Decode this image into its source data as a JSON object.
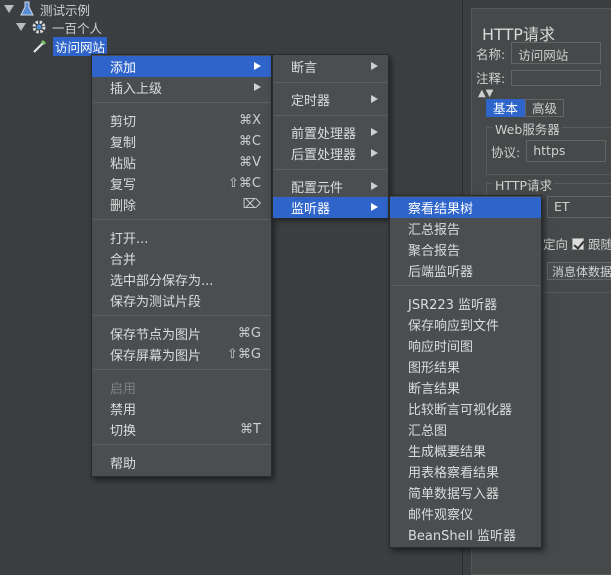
{
  "tree": {
    "root": "测试示例",
    "thread_group": "一百个人",
    "sampler": "访问网站"
  },
  "panel": {
    "title": "HTTP请求",
    "name_label": "名称:",
    "name_value": "访问网站",
    "comment_label": "注释:",
    "tab_basic": "基本",
    "tab_advanced": "高级",
    "web_server_group": "Web服务器",
    "protocol_label": "协议:",
    "protocol_value": "https",
    "http_request_group": "HTTP请求",
    "method_value": "ET",
    "redirect_label": "定向",
    "follow_label": "跟随",
    "body_tab": "消息体数据",
    "extra_tab": "文"
  },
  "context_menu": {
    "items": [
      {
        "label": "添加",
        "shortcut": "",
        "submenu": true,
        "highlighted": true,
        "disabled": false
      },
      {
        "label": "插入上级",
        "shortcut": "",
        "submenu": true,
        "highlighted": false,
        "disabled": false
      },
      {
        "label": "剪切",
        "shortcut": "⌘X",
        "submenu": false,
        "highlighted": false,
        "disabled": false
      },
      {
        "label": "复制",
        "shortcut": "⌘C",
        "submenu": false,
        "highlighted": false,
        "disabled": false
      },
      {
        "label": "粘贴",
        "shortcut": "⌘V",
        "submenu": false,
        "highlighted": false,
        "disabled": false
      },
      {
        "label": "复写",
        "shortcut": "⇧⌘C",
        "submenu": false,
        "highlighted": false,
        "disabled": false
      },
      {
        "label": "删除",
        "shortcut": "⌦",
        "submenu": false,
        "highlighted": false,
        "disabled": false
      },
      {
        "label": "打开...",
        "shortcut": "",
        "submenu": false,
        "highlighted": false,
        "disabled": false
      },
      {
        "label": "合并",
        "shortcut": "",
        "submenu": false,
        "highlighted": false,
        "disabled": false
      },
      {
        "label": "选中部分保存为...",
        "shortcut": "",
        "submenu": false,
        "highlighted": false,
        "disabled": false
      },
      {
        "label": "保存为测试片段",
        "shortcut": "",
        "submenu": false,
        "highlighted": false,
        "disabled": false
      },
      {
        "label": "保存节点为图片",
        "shortcut": "⌘G",
        "submenu": false,
        "highlighted": false,
        "disabled": false
      },
      {
        "label": "保存屏幕为图片",
        "shortcut": "⇧⌘G",
        "submenu": false,
        "highlighted": false,
        "disabled": false
      },
      {
        "label": "启用",
        "shortcut": "",
        "submenu": false,
        "highlighted": false,
        "disabled": true
      },
      {
        "label": "禁用",
        "shortcut": "",
        "submenu": false,
        "highlighted": false,
        "disabled": false
      },
      {
        "label": "切换",
        "shortcut": "⌘T",
        "submenu": false,
        "highlighted": false,
        "disabled": false
      },
      {
        "label": "帮助",
        "shortcut": "",
        "submenu": false,
        "highlighted": false,
        "disabled": false
      }
    ]
  },
  "add_submenu": {
    "items": [
      {
        "label": "断言",
        "highlighted": false
      },
      {
        "label": "定时器",
        "highlighted": false
      },
      {
        "label": "前置处理器",
        "highlighted": false
      },
      {
        "label": "后置处理器",
        "highlighted": false
      },
      {
        "label": "配置元件",
        "highlighted": false
      },
      {
        "label": "监听器",
        "highlighted": true
      }
    ]
  },
  "listener_submenu": {
    "items": [
      {
        "label": "察看结果树",
        "highlighted": true
      },
      {
        "label": "汇总报告",
        "highlighted": false
      },
      {
        "label": "聚合报告",
        "highlighted": false
      },
      {
        "label": "后端监听器",
        "highlighted": false
      },
      {
        "label": "JSR223 监听器",
        "highlighted": false
      },
      {
        "label": "保存响应到文件",
        "highlighted": false
      },
      {
        "label": "响应时间图",
        "highlighted": false
      },
      {
        "label": "图形结果",
        "highlighted": false
      },
      {
        "label": "断言结果",
        "highlighted": false
      },
      {
        "label": "比较断言可视化器",
        "highlighted": false
      },
      {
        "label": "汇总图",
        "highlighted": false
      },
      {
        "label": "生成概要结果",
        "highlighted": false
      },
      {
        "label": "用表格察看结果",
        "highlighted": false
      },
      {
        "label": "简单数据写入器",
        "highlighted": false
      },
      {
        "label": "邮件观察仪",
        "highlighted": false
      },
      {
        "label": "BeanShell 监听器",
        "highlighted": false
      }
    ]
  },
  "colors": {
    "background": "#3c3f41",
    "menu_bg": "#4a4e50",
    "highlight": "#2f65ca"
  }
}
